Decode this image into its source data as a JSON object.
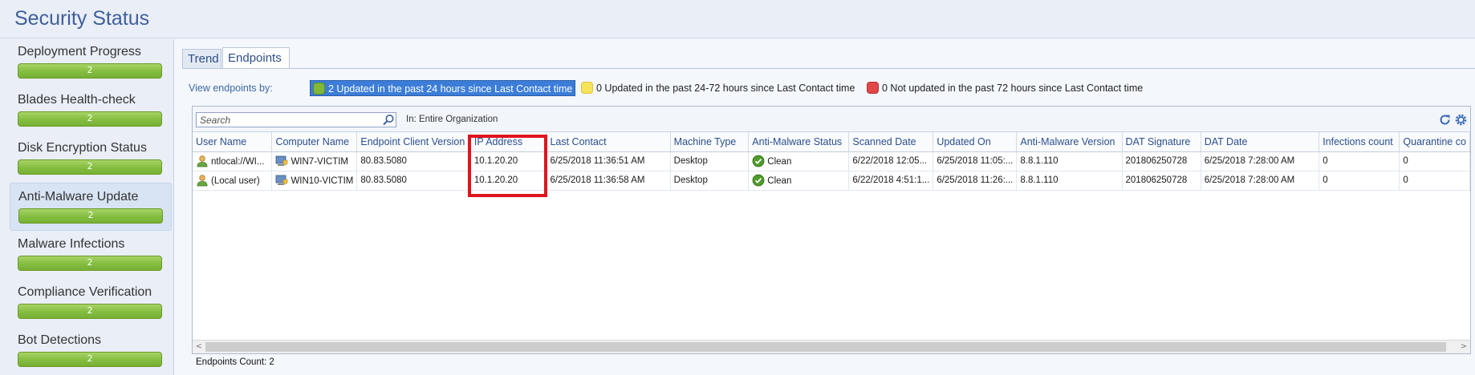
{
  "page": {
    "title": "Security Status"
  },
  "sidebar": {
    "items": [
      {
        "label": "Deployment Progress",
        "value": "2"
      },
      {
        "label": "Blades Health-check",
        "value": "2"
      },
      {
        "label": "Disk Encryption Status",
        "value": "2"
      },
      {
        "label": "Anti-Malware Update",
        "value": "2",
        "active": true
      },
      {
        "label": "Malware Infections",
        "value": "2"
      },
      {
        "label": "Compliance Verification",
        "value": "2"
      },
      {
        "label": "Bot Detections",
        "value": "2"
      }
    ]
  },
  "tabs": {
    "trend": "Trend",
    "endpoints": "Endpoints",
    "active": "Endpoints"
  },
  "filters": {
    "label": "View endpoints by:",
    "options": [
      {
        "text": "2 Updated in the past 24 hours since Last Contact time",
        "color": "#7fb838",
        "selected": true
      },
      {
        "text": "0 Updated in the past 24-72 hours since Last Contact time",
        "color": "#f7e35a",
        "selected": false
      },
      {
        "text": "0 Not updated in the past 72 hours since Last Contact time",
        "color": "#e04848",
        "selected": false
      }
    ]
  },
  "toolbar": {
    "search_placeholder": "Search",
    "scope": "In: Entire Organization",
    "icons": [
      "search-icon",
      "refresh-icon",
      "settings-icon"
    ]
  },
  "table": {
    "columns": [
      "User Name",
      "Computer Name",
      "Endpoint Client Version",
      "IP Address",
      "Last Contact",
      "Machine Type",
      "Anti-Malware Status",
      "Scanned Date",
      "Updated On",
      "Anti-Malware Version",
      "DAT Signature",
      "DAT Date",
      "Infections count",
      "Quarantine co"
    ],
    "rows": [
      [
        "ntlocal://WI...",
        "WIN7-VICTIM",
        "80.83.5080",
        "10.1.20.20",
        "6/25/2018 11:36:51 AM",
        "Desktop",
        "Clean",
        "6/22/2018 12:05...",
        "6/25/2018 11:05:...",
        "8.8.1.110",
        "201806250728",
        "6/25/2018 7:28:00 AM",
        "0",
        "0"
      ],
      [
        "(Local user)",
        "WIN10-VICTIM",
        "80.83.5080",
        "10.1.20.20",
        "6/25/2018 11:36:58 AM",
        "Desktop",
        "Clean",
        "6/22/2018 4:51:1...",
        "6/25/2018 11:26:...",
        "8.8.1.110",
        "201806250728",
        "6/25/2018 7:28:00 AM",
        "0",
        "0"
      ]
    ],
    "status_color": "#4e9a2a"
  },
  "footer": {
    "count_text": "Endpoints Count: 2"
  },
  "annotation": {
    "highlight_color": "#e0141e",
    "highlighted_column": "IP Address"
  },
  "scrollbar": {
    "left_arrow": "<",
    "right_arrow": ">"
  }
}
